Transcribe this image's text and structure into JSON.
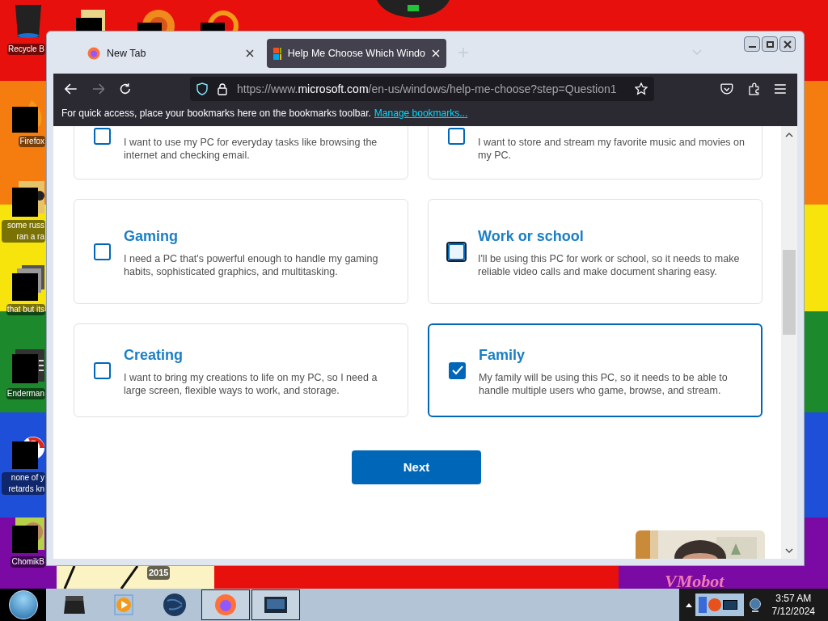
{
  "desktop": {
    "icons": [
      {
        "label": "Recycle B",
        "kind": "bin"
      },
      {
        "label": "Firefox",
        "kind": "firefox"
      },
      {
        "label": "some russ ran a ra",
        "kind": "doc"
      },
      {
        "label": "that but its",
        "kind": "stack"
      },
      {
        "label": "Enderman",
        "kind": "window"
      },
      {
        "label": "none of y retards kn",
        "kind": "disc"
      },
      {
        "label": "ChomikB",
        "kind": "animal"
      }
    ],
    "wallpaper_texts": [
      "2015",
      "VMobot"
    ]
  },
  "browser": {
    "tabs": [
      {
        "title": "New Tab",
        "selected": false
      },
      {
        "title": "Help Me Choose Which Windo",
        "selected": true
      }
    ],
    "url": {
      "start": "https://www.",
      "domain": "microsoft.com",
      "rest": "/en-us/windows/help-me-choose?step=Question1"
    },
    "bookmarks_hint": "For quick access, place your bookmarks here on the bookmarks toolbar.",
    "bookmarks_link": "Manage bookmarks...",
    "options": [
      {
        "description": "I want to use my PC for everyday tasks like browsing the internet and checking email.",
        "checked": false,
        "focused": false
      },
      {
        "description": "I want to store and stream my favorite music and movies on my PC.",
        "checked": false,
        "focused": false
      },
      {
        "title": "Gaming",
        "description": "I need a PC that's powerful enough to handle my gaming habits, sophisticated graphics, and multitasking.",
        "checked": false,
        "focused": false
      },
      {
        "title": "Work or school",
        "description": "I'll be using this PC for work or school, so it needs to make reliable video calls and make document sharing easy.",
        "checked": false,
        "focused": true
      },
      {
        "title": "Creating",
        "description": "I want to bring my creations to life on my PC, so I need a large screen, flexible ways to work, and storage.",
        "checked": false,
        "focused": false
      },
      {
        "title": "Family",
        "description": "My family will be using this PC, so it needs to be able to handle multiple users who game, browse, and stream.",
        "checked": true,
        "focused": false
      }
    ],
    "next_button": "Next"
  },
  "taskbar": {
    "time": "3:57 AM",
    "date": "7/12/2024"
  }
}
